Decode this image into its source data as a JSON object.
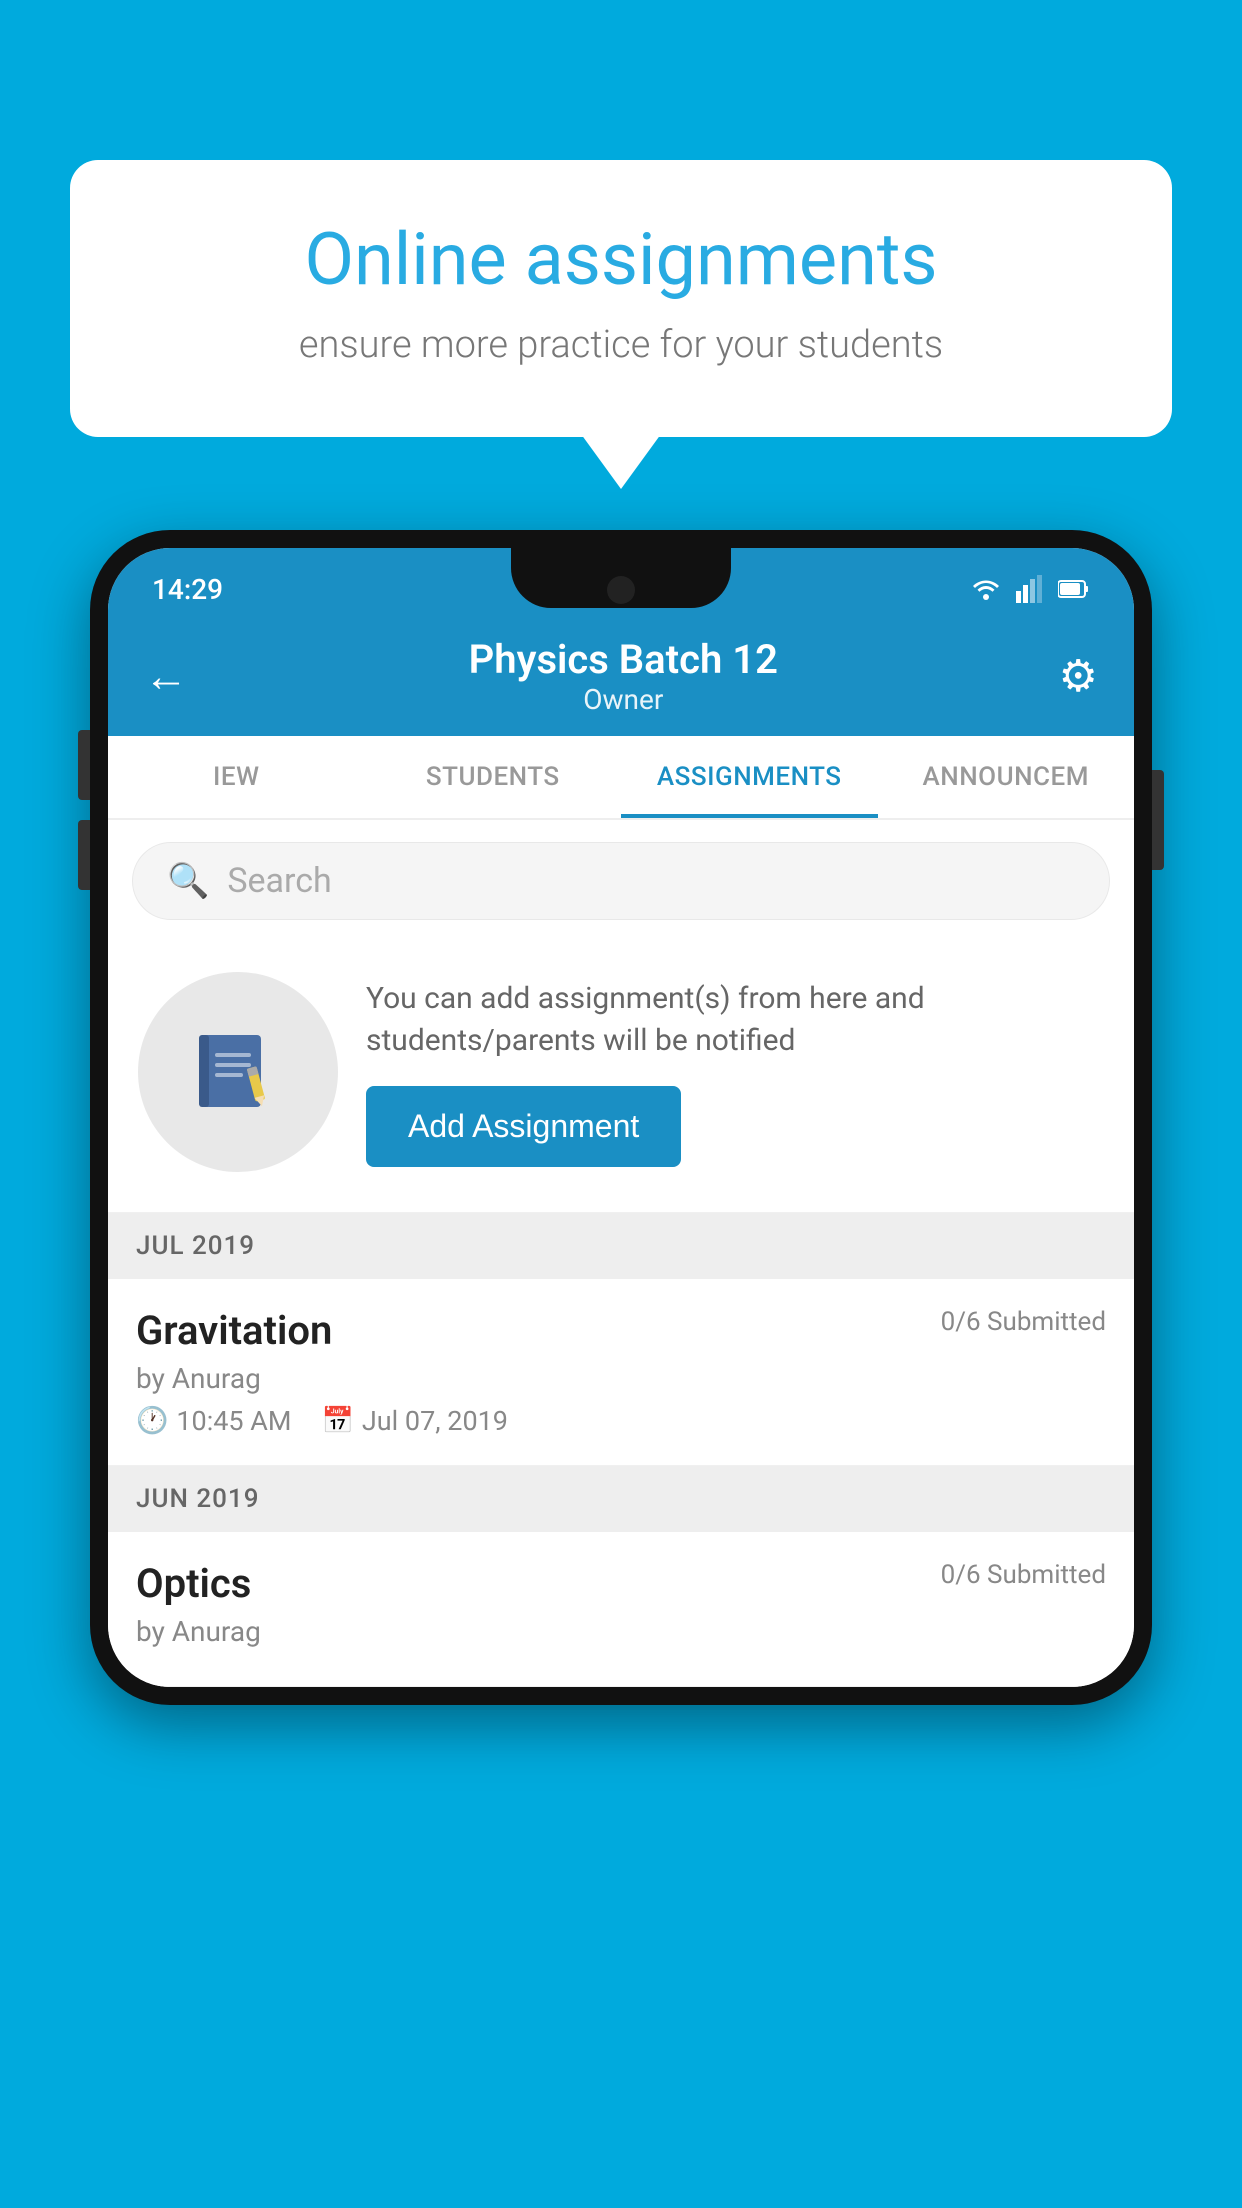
{
  "background_color": "#00AADD",
  "speech_bubble": {
    "title": "Online assignments",
    "subtitle": "ensure more practice for your students"
  },
  "phone": {
    "status_bar": {
      "time": "14:29"
    },
    "app_bar": {
      "title": "Physics Batch 12",
      "subtitle": "Owner",
      "back_label": "←",
      "settings_label": "⚙"
    },
    "tabs": [
      {
        "label": "IEW",
        "active": false
      },
      {
        "label": "STUDENTS",
        "active": false
      },
      {
        "label": "ASSIGNMENTS",
        "active": true
      },
      {
        "label": "ANNOUNCEM",
        "active": false
      }
    ],
    "search": {
      "placeholder": "Search"
    },
    "promo": {
      "description": "You can add assignment(s) from here and students/parents will be notified",
      "button_label": "Add Assignment"
    },
    "sections": [
      {
        "header": "JUL 2019",
        "assignments": [
          {
            "name": "Gravitation",
            "submitted": "0/6 Submitted",
            "author": "by Anurag",
            "time": "10:45 AM",
            "date": "Jul 07, 2019"
          }
        ]
      },
      {
        "header": "JUN 2019",
        "assignments": [
          {
            "name": "Optics",
            "submitted": "0/6 Submitted",
            "author": "by Anurag",
            "time": "",
            "date": ""
          }
        ]
      }
    ]
  }
}
